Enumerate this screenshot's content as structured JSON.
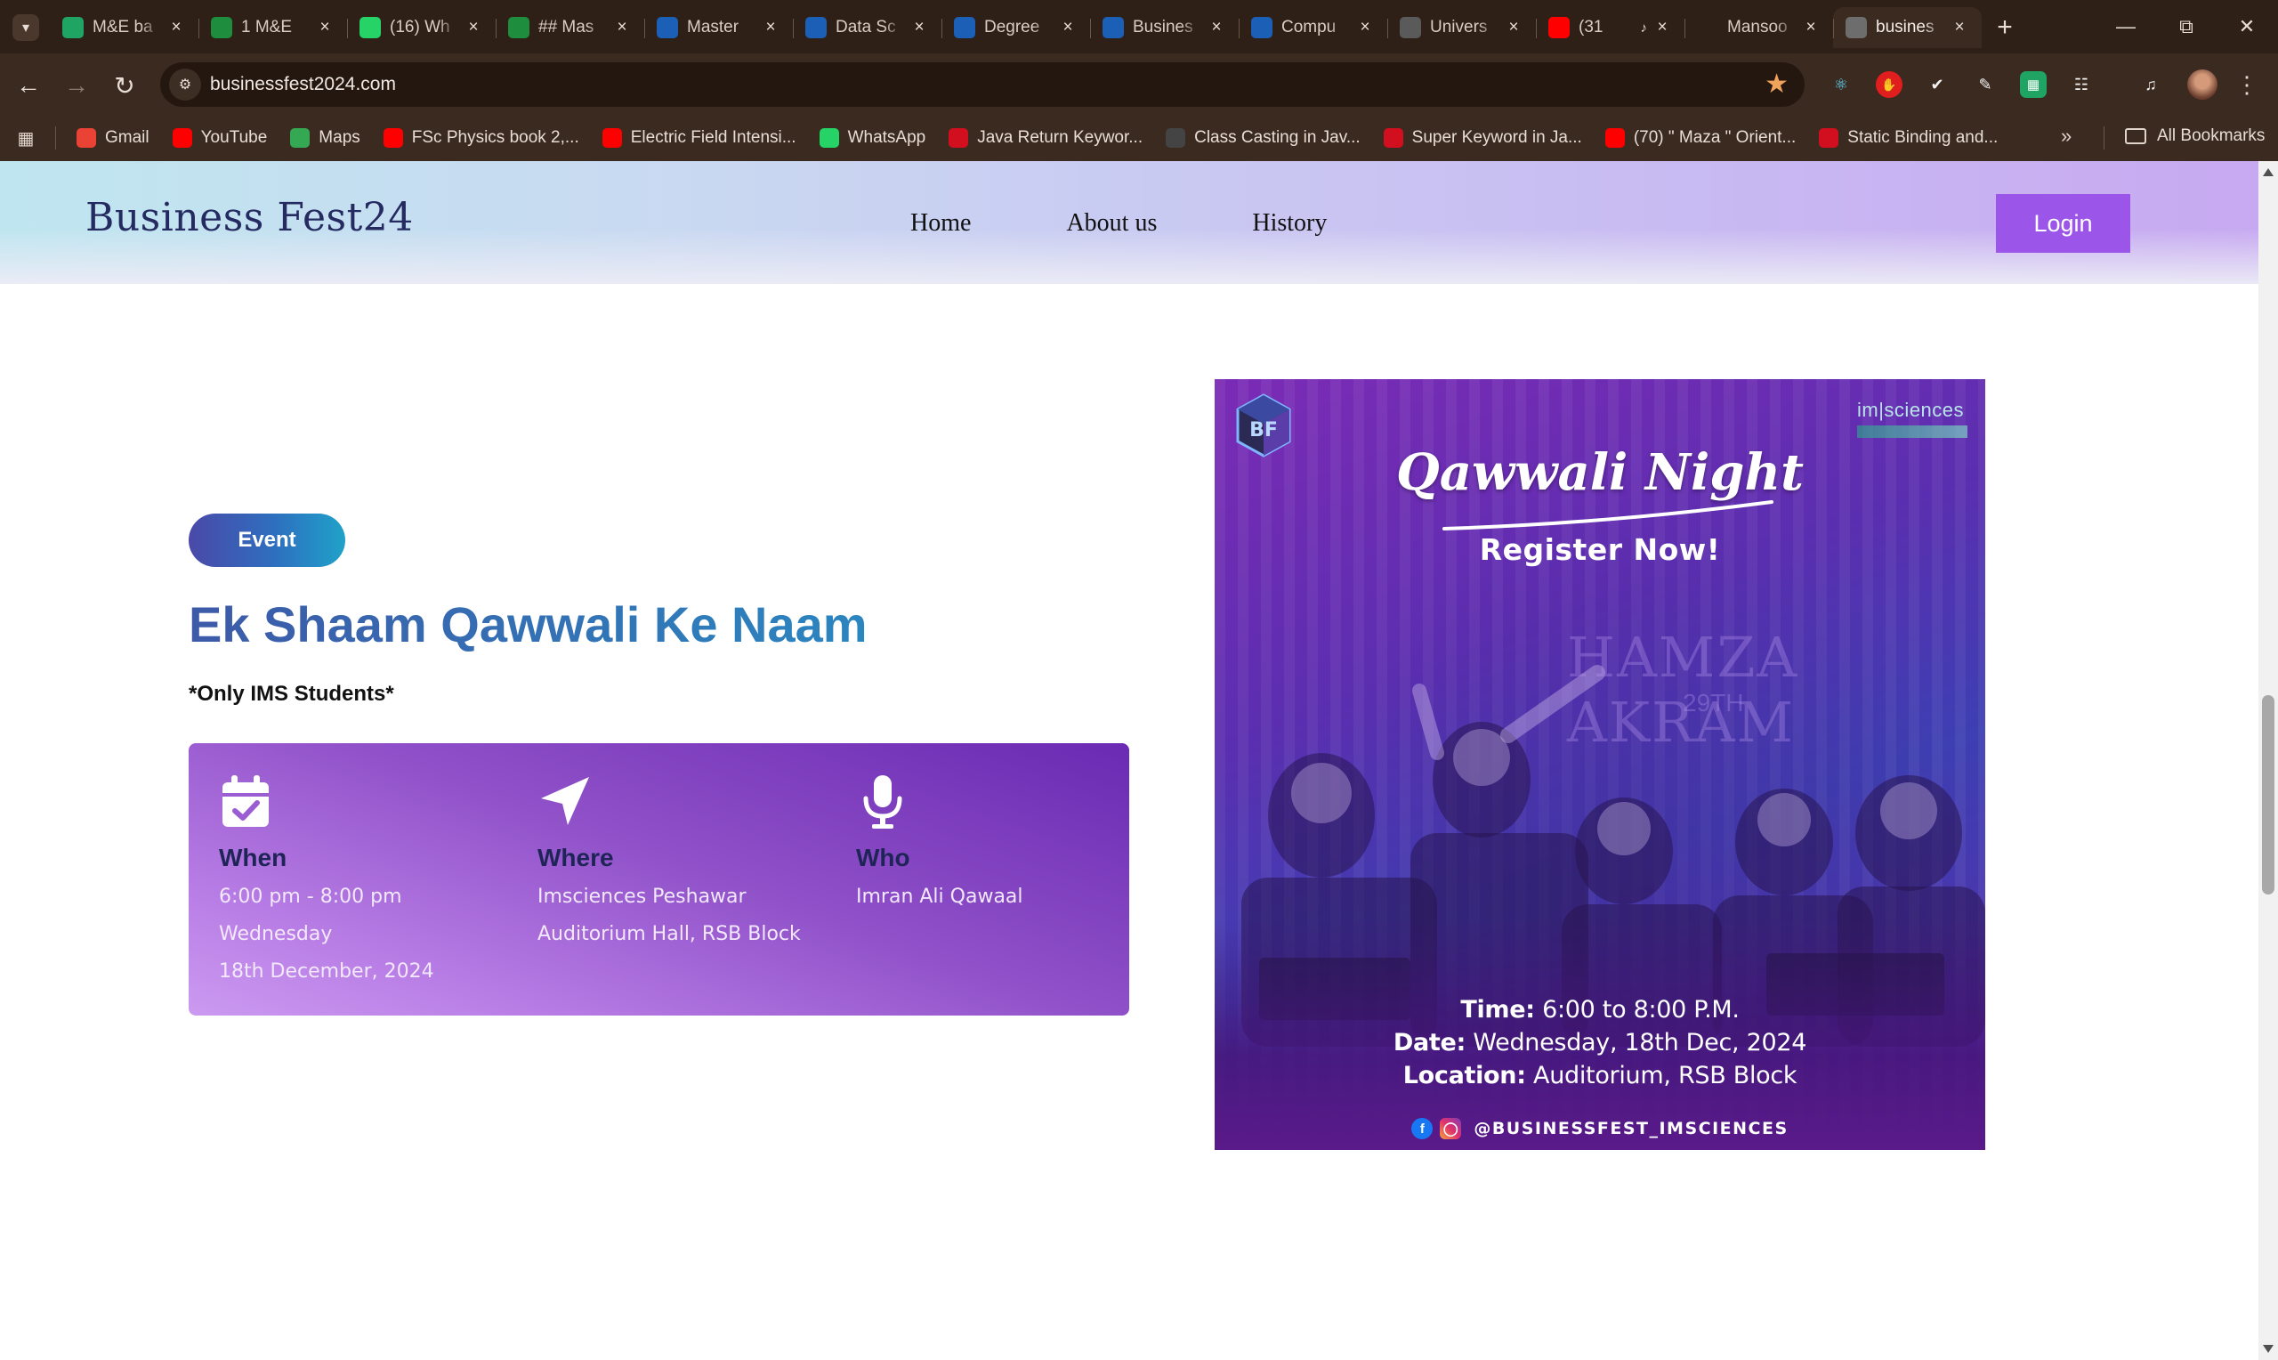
{
  "browser": {
    "tabs": [
      {
        "title": "M&E ba",
        "icon": "google-drive-icon",
        "color": "#1fa463"
      },
      {
        "title": "1 M&E",
        "icon": "google-sheets-icon",
        "color": "#1e8e3e"
      },
      {
        "title": "(16) Wh",
        "icon": "whatsapp-icon",
        "color": "#25d366"
      },
      {
        "title": "## Mas",
        "icon": "google-sheets-icon",
        "color": "#1e8e3e"
      },
      {
        "title": "Master",
        "icon": "university-icon",
        "color": "#1b5fb6"
      },
      {
        "title": "Data Sc",
        "icon": "university-icon",
        "color": "#1b5fb6"
      },
      {
        "title": "Degree",
        "icon": "university-icon",
        "color": "#1b5fb6"
      },
      {
        "title": "Busines",
        "icon": "university-icon",
        "color": "#1b5fb6"
      },
      {
        "title": "Compu",
        "icon": "university-icon",
        "color": "#1b5fb6"
      },
      {
        "title": "Univers",
        "icon": "openai-icon",
        "color": "#5a5a5a"
      },
      {
        "title": "(31",
        "icon": "youtube-icon",
        "color": "#ff0000",
        "audio": true
      },
      {
        "title": "Mansoo",
        "icon": "blank-icon",
        "color": "#2e1f17"
      },
      {
        "title": "busines",
        "icon": "globe-icon",
        "color": "#6d6d6d",
        "active": true
      }
    ],
    "url": "businessfest2024.com",
    "bookmarks": [
      {
        "label": "Gmail",
        "icon": "gmail-icon",
        "color": "#ea4335"
      },
      {
        "label": "YouTube",
        "icon": "youtube-icon",
        "color": "#ff0000"
      },
      {
        "label": "Maps",
        "icon": "maps-icon",
        "color": "#34a853"
      },
      {
        "label": "FSc Physics book 2,...",
        "icon": "youtube-icon",
        "color": "#ff0000"
      },
      {
        "label": "Electric Field Intensi...",
        "icon": "youtube-icon",
        "color": "#ff0000"
      },
      {
        "label": "WhatsApp",
        "icon": "whatsapp-icon",
        "color": "#25d366"
      },
      {
        "label": "Java Return Keywor...",
        "icon": "javatpoint-icon",
        "color": "#d10f1f"
      },
      {
        "label": "Class Casting in Jav...",
        "icon": "site-icon",
        "color": "#444444"
      },
      {
        "label": "Super Keyword in Ja...",
        "icon": "javatpoint-icon",
        "color": "#d10f1f"
      },
      {
        "label": "(70) \" Maza \" Orient...",
        "icon": "youtube-icon",
        "color": "#ff0000"
      },
      {
        "label": "Static Binding and...",
        "icon": "javatpoint-icon",
        "color": "#d10f1f"
      }
    ],
    "all_bookmarks": "All Bookmarks"
  },
  "site": {
    "logo": "Business Fest24",
    "nav": [
      "Home",
      "About us",
      "History"
    ],
    "login": "Login"
  },
  "event": {
    "badge": "Event",
    "title": "Ek Shaam Qawwali Ke Naam",
    "note": "*Only IMS Students*",
    "when": {
      "heading": "When",
      "lines": [
        "6:00 pm - 8:00 pm",
        "Wednesday",
        "18th December, 2024"
      ]
    },
    "where": {
      "heading": "Where",
      "lines": [
        "Imsciences Peshawar",
        "Auditorium Hall, RSB Block"
      ]
    },
    "who": {
      "heading": "Who",
      "lines": [
        "Imran Ali Qawaal"
      ]
    }
  },
  "poster": {
    "org_logo": "im|sciences",
    "title": "Qawwali Night",
    "subtitle": "Register Now!",
    "watermark": "HAMZA AKRAM",
    "watermark_date": "29TH",
    "time_label": "Time:",
    "time_value": "6:00 to 8:00 P.M.",
    "date_label": "Date:",
    "date_value": "Wednesday, 18th Dec, 2024",
    "location_label": "Location:",
    "location_value": "Auditorium, RSB Block",
    "handle": "@BUSINESSFEST_IMSCIENCES"
  }
}
